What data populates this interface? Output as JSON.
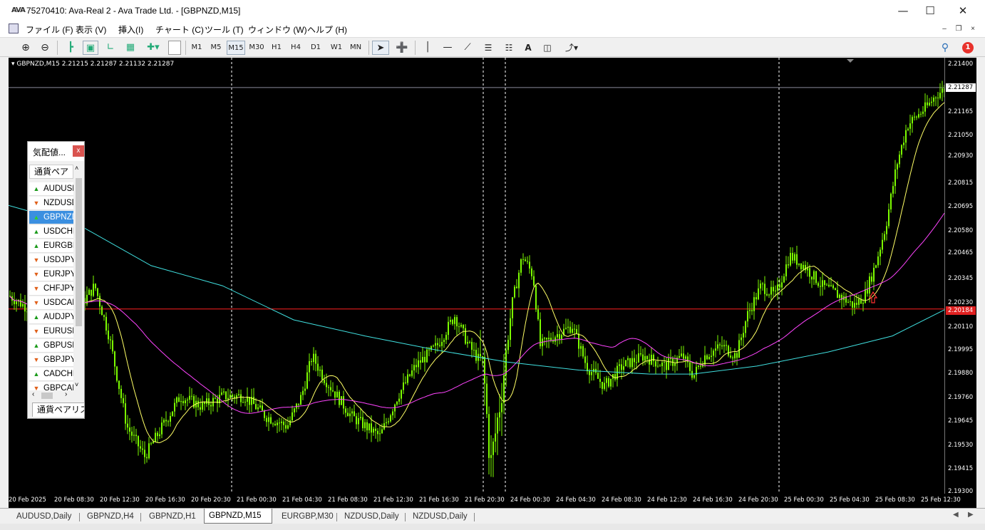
{
  "window": {
    "logo": "AVA",
    "title": "75270410: Ava-Real 2 - Ava Trade Ltd. - [GBPNZD,M15]"
  },
  "menu": [
    "ファイル (F)",
    "表示 (V)",
    "挿入(I)",
    "チャート (C)",
    "ツール (T)",
    "ウィンドウ (W)",
    "ヘルプ (H)"
  ],
  "toolbar": {
    "timeframes": [
      "M1",
      "M5",
      "M15",
      "M30",
      "H1",
      "H4",
      "D1",
      "W1",
      "MN"
    ],
    "active_timeframe": "M15",
    "notification_count": "1"
  },
  "chart": {
    "symbol_info": "GBPNZD,M15  2.21215 2.21287 2.21132 2.21287",
    "bid_price": "2.21287",
    "line_price": "2.20184",
    "price_labels": [
      "2.21400",
      "2.21287",
      "2.21165",
      "2.21050",
      "2.20930",
      "2.20815",
      "2.20695",
      "2.20580",
      "2.20465",
      "2.20345",
      "2.20230",
      "2.20184",
      "2.20110",
      "2.19995",
      "2.19880",
      "2.19760",
      "2.19645",
      "2.19530",
      "2.19415",
      "2.19300"
    ],
    "time_labels": [
      "20 Feb 2025",
      "20 Feb 08:30",
      "20 Feb 12:30",
      "20 Feb 16:30",
      "20 Feb 20:30",
      "21 Feb 00:30",
      "21 Feb 04:30",
      "21 Feb 08:30",
      "21 Feb 12:30",
      "21 Feb 16:30",
      "21 Feb 20:30",
      "24 Feb 00:30",
      "24 Feb 04:30",
      "24 Feb 08:30",
      "24 Feb 12:30",
      "24 Feb 16:30",
      "24 Feb 20:30",
      "25 Feb 00:30",
      "25 Feb 04:30",
      "25 Feb 08:30",
      "25 Feb 12:30"
    ],
    "colors": {
      "background": "#000000",
      "candle": "#7cfc00",
      "ma_fast": "#ffff66",
      "ma_mid": "#ff44ff",
      "ma_slow": "#40e0e0",
      "hline": "#ff2020",
      "arrow": "#ff3030",
      "grid_sep": "#ffffff"
    }
  },
  "market_watch": {
    "title": "気配値...",
    "close": "x",
    "column_header": "通貨ペア",
    "rows": [
      {
        "symbol": "AUDUSD",
        "dir": "up"
      },
      {
        "symbol": "NZDUSD",
        "dir": "down"
      },
      {
        "symbol": "GBPNZD",
        "dir": "up",
        "selected": true
      },
      {
        "symbol": "USDCHF",
        "dir": "up"
      },
      {
        "symbol": "EURGBP",
        "dir": "up"
      },
      {
        "symbol": "USDJPY",
        "dir": "down"
      },
      {
        "symbol": "EURJPY",
        "dir": "down"
      },
      {
        "symbol": "CHFJPY",
        "dir": "down"
      },
      {
        "symbol": "USDCAD",
        "dir": "down"
      },
      {
        "symbol": "AUDJPY",
        "dir": "up"
      },
      {
        "symbol": "EURUSD",
        "dir": "down"
      },
      {
        "symbol": "GBPUSD",
        "dir": "up"
      },
      {
        "symbol": "GBPJPY",
        "dir": "down"
      },
      {
        "symbol": "CADCHF",
        "dir": "up"
      },
      {
        "symbol": "GBPCAD",
        "dir": "down"
      }
    ],
    "footer_tab": "通貨ペアリスト"
  },
  "tabs": [
    "AUDUSD,Daily",
    "GBPNZD,H4",
    "GBPNZD,H1",
    "GBPNZD,M15",
    "EURGBP,M30",
    "NZDUSD,Daily",
    "NZDUSD,Daily"
  ],
  "active_tab": "GBPNZD,M15"
}
